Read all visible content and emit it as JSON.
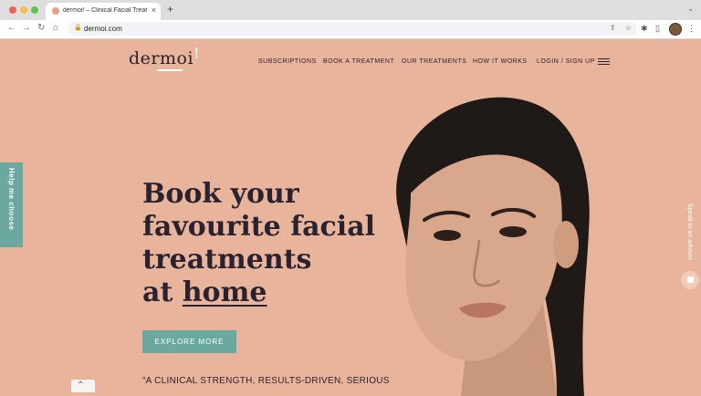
{
  "browser": {
    "tab_title": "dermoi! – Clinical Facial Treatm...",
    "tab_close": "×",
    "new_tab": "+",
    "tab_menu": "⌄",
    "back": "←",
    "forward": "→",
    "reload": "↻",
    "home": "⌂",
    "lock": "🔒",
    "url": "dermoi.com",
    "share": "⇪",
    "bookmark": "☆",
    "extensions": "✱",
    "side_panel": "▯",
    "menu": "⋮"
  },
  "site": {
    "logo_text": "dermoi",
    "logo_mark": "!",
    "nav": {
      "subscriptions": "SUBSCRIPTIONS",
      "book": "BOOK A TREATMENT",
      "treatments": "OUR TREATMENTS",
      "how": "HOW IT WORKS",
      "login": "LOGIN / SIGN UP"
    },
    "hero": {
      "line1": "Book your",
      "line2": "favourite facial",
      "line3": "treatments",
      "line4_prefix": "at ",
      "line4_home": "home"
    },
    "cta": "EXPLORE MORE",
    "quote": "“A CLINICAL STRENGTH, RESULTS-DRIVEN, SERIOUS",
    "help_tab": "Help me choose",
    "speak": "Speak to an advisor",
    "scroll_up": "⌃"
  },
  "colors": {
    "page_bg": "#e9b49c",
    "accent": "#6aa8a0",
    "text": "#2b2230"
  }
}
